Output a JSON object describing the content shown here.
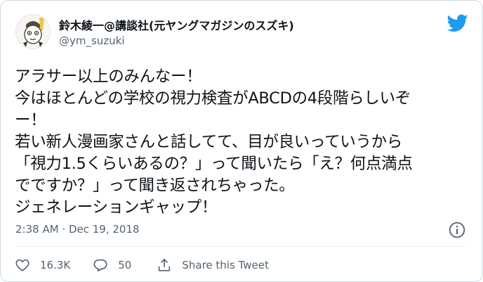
{
  "author": {
    "display_name": "鈴木綾一@講談社(元ヤングマガジンのスズキ)",
    "handle": "@ym_suzuki",
    "avatar_icon": "avatar-illustration"
  },
  "tweet": {
    "lines": [
      "アラサー以上のみんなー！",
      "今はほとんどの学校の視力検査がABCDの4段階らしいぞ",
      "ー！",
      "若い新人漫画家さんと話してて、目が良いっていうから",
      "「視力1.5くらいあるの？」って聞いたら「え？何点満点",
      "でですか？」って聞き返されちゃった。",
      "ジェネレーションギャップ！"
    ]
  },
  "meta": {
    "timestamp": "2:38 AM · Dec 19, 2018"
  },
  "actions": {
    "likes": "16.3K",
    "replies": "50",
    "share_label": "Share this Tweet"
  },
  "colors": {
    "twitter_blue": "#1d9bf0",
    "secondary_text": "#536471",
    "border": "#cfd9de"
  },
  "icons": {
    "logo": "twitter-bird-icon",
    "info": "info-icon",
    "like": "heart-icon",
    "reply": "reply-bubble-icon",
    "share": "share-icon"
  }
}
